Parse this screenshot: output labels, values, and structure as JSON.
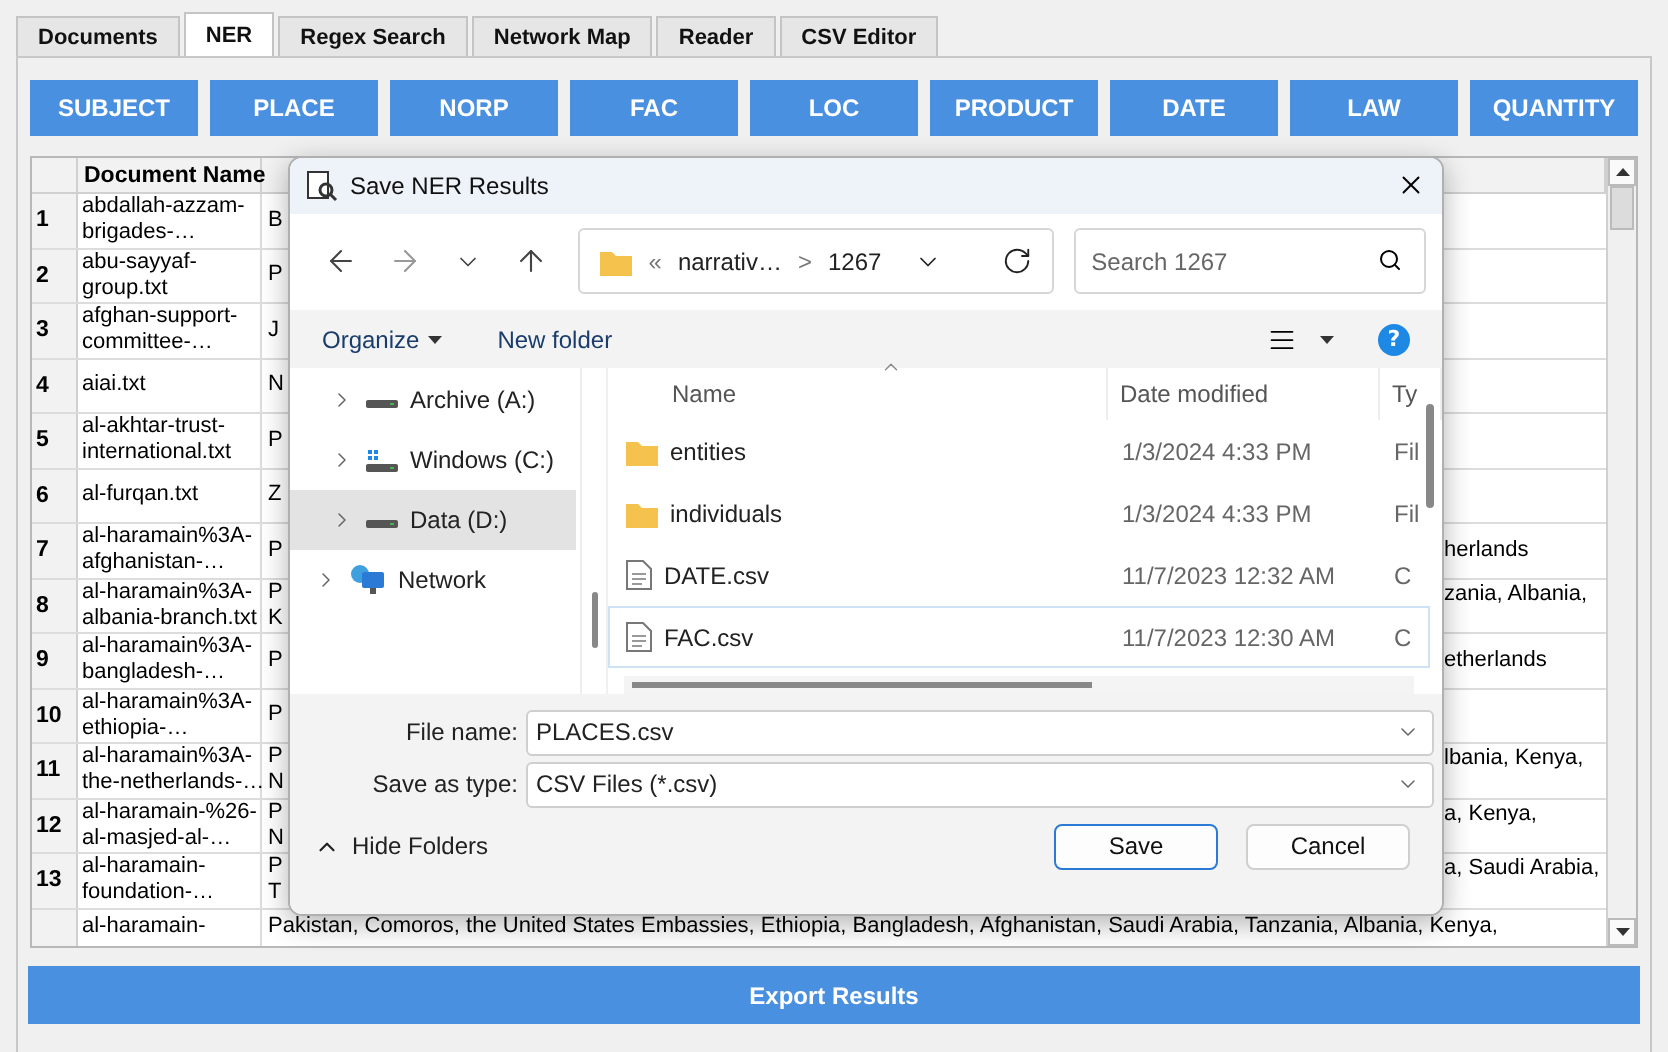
{
  "tabs": [
    {
      "label": "Documents",
      "selected": false
    },
    {
      "label": "NER",
      "selected": true
    },
    {
      "label": "Regex Search",
      "selected": false
    },
    {
      "label": "Network Map",
      "selected": false
    },
    {
      "label": "Reader",
      "selected": false
    },
    {
      "label": "CSV Editor",
      "selected": false
    }
  ],
  "entity_buttons": [
    "SUBJECT",
    "PLACE",
    "NORP",
    "FAC",
    "LOC",
    "PRODUCT",
    "DATE",
    "LAW",
    "QUANTITY"
  ],
  "table": {
    "columns": [
      "Document Name"
    ],
    "rows": [
      {
        "number": "1",
        "document_name": [
          "abdallah-azzam-",
          "brigades-…"
        ],
        "entities_start": [
          "B"
        ]
      },
      {
        "number": "2",
        "document_name": [
          "abu-sayyaf-",
          "group.txt"
        ],
        "entities_start": [
          "P"
        ]
      },
      {
        "number": "3",
        "document_name": [
          "afghan-support-",
          "committee-…"
        ],
        "entities_start": [
          "J"
        ]
      },
      {
        "number": "4",
        "document_name": [
          "aiai.txt"
        ],
        "entities_start": [
          "N"
        ]
      },
      {
        "number": "5",
        "document_name": [
          "al-akhtar-trust-",
          "international.txt"
        ],
        "entities_start": [
          "P"
        ]
      },
      {
        "number": "6",
        "document_name": [
          "al-furqan.txt"
        ],
        "entities_start": [
          "Z"
        ]
      },
      {
        "number": "7",
        "document_name": [
          "al-haramain%3A-",
          "afghanistan-…"
        ],
        "entities_start": [
          "P"
        ],
        "entities_end": "herlands"
      },
      {
        "number": "8",
        "document_name": [
          "al-haramain%3A-",
          "albania-branch.txt"
        ],
        "entities_start": [
          "P",
          "K"
        ],
        "entities_end": "zania, Albania,"
      },
      {
        "number": "9",
        "document_name": [
          "al-haramain%3A-",
          "bangladesh-…"
        ],
        "entities_start": [
          "P"
        ],
        "entities_end": "etherlands"
      },
      {
        "number": "10",
        "document_name": [
          "al-haramain%3A-",
          "ethiopia-…"
        ],
        "entities_start": [
          "P"
        ]
      },
      {
        "number": "11",
        "document_name": [
          "al-haramain%3A-",
          "the-netherlands-…"
        ],
        "entities_start": [
          "P",
          "N"
        ],
        "entities_end": "lbania, Kenya,"
      },
      {
        "number": "12",
        "document_name": [
          "al-haramain-%26-",
          "al-masjed-al-…"
        ],
        "entities_start": [
          "P",
          "N"
        ],
        "entities_end": "a, Kenya,"
      },
      {
        "number": "13",
        "document_name": [
          "al-haramain-",
          "foundation-…"
        ],
        "entities_start": [
          "P",
          "T"
        ],
        "entities_end": "a, Saudi Arabia,"
      },
      {
        "document_name": [
          "al-haramain-"
        ],
        "entities_start": [
          "Pakistan, Comoros, the United States Embassies, Ethiopia, Bangladesh, Afghanistan, Saudi Arabia, Tanzania, Albania, Kenya,"
        ]
      }
    ]
  },
  "dialog": {
    "title": "Save NER Results",
    "breadcrumb": {
      "separator": "«",
      "parent": "narrativ…",
      "arrow": ">",
      "current": "1267"
    },
    "search": {
      "placeholder": "Search 1267"
    },
    "toolbar": {
      "organize": "Organize",
      "new_folder": "New folder",
      "help": "?"
    },
    "tree": [
      {
        "label": "Archive (A:)",
        "kind": "drive",
        "selected": false
      },
      {
        "label": "Windows (C:)",
        "kind": "system",
        "selected": false
      },
      {
        "label": "Data (D:)",
        "kind": "drive",
        "selected": true
      },
      {
        "label": "Network",
        "kind": "network",
        "selected": false
      }
    ],
    "file_columns": [
      "Name",
      "Date modified",
      "Ty"
    ],
    "files": [
      {
        "name": "entities",
        "kind": "folder",
        "date": "1/3/2024 4:33 PM",
        "type": "Fil",
        "selected": false
      },
      {
        "name": "individuals",
        "kind": "folder",
        "date": "1/3/2024 4:33 PM",
        "type": "Fil",
        "selected": false
      },
      {
        "name": "DATE.csv",
        "kind": "file",
        "date": "11/7/2023 12:32 AM",
        "type": "C",
        "selected": false
      },
      {
        "name": "FAC.csv",
        "kind": "file",
        "date": "11/7/2023 12:30 AM",
        "type": "C",
        "selected": true
      }
    ],
    "file_name": {
      "label": "File name:",
      "value": "PLACES.csv"
    },
    "save_type": {
      "label": "Save as type:",
      "value": "CSV Files (*.csv)"
    },
    "hide_folders": "Hide Folders",
    "buttons": [
      "Save",
      "Cancel"
    ]
  },
  "export_button": "Export Results"
}
